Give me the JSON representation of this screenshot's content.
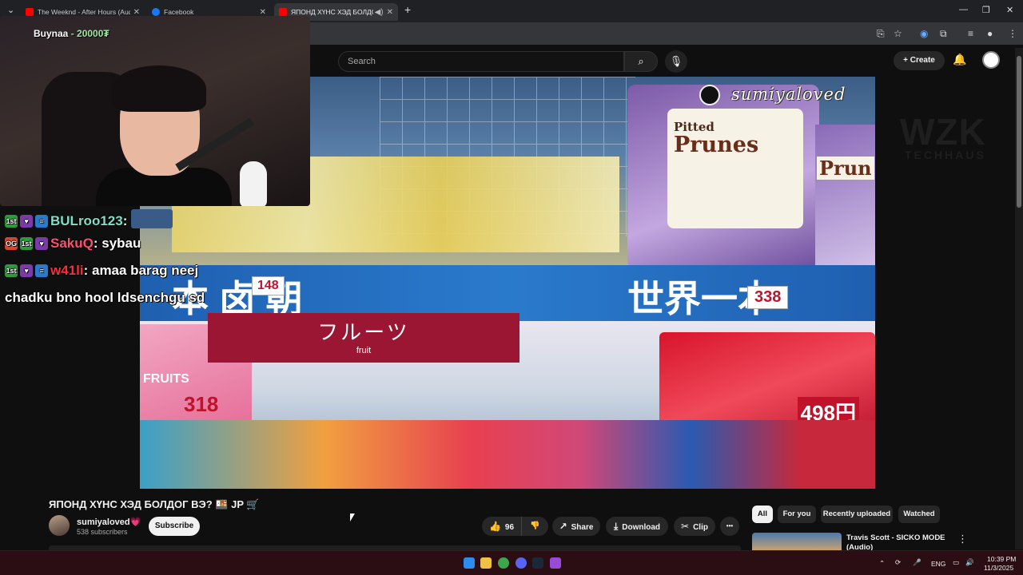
{
  "browser": {
    "tabs": [
      {
        "title": "The Weeknd - After Hours (Aud",
        "icon": "youtube-icon",
        "color": "#ff0000"
      },
      {
        "title": "Facebook",
        "icon": "facebook-icon",
        "color": "#1877f2"
      },
      {
        "title": "ЯПОНД ХҮНС ХЭД БОЛДОГ",
        "icon": "youtube-icon",
        "color": "#ff0000"
      }
    ],
    "new_tab": "+",
    "window_controls": [
      "—",
      "❐",
      "✕"
    ]
  },
  "youtube": {
    "search_placeholder": "Search",
    "create_label": "Create",
    "video": {
      "title": "ЯПОНД ХҮНС ХЭД БОЛДОГ ВЭ? 🍱 JP 🛒",
      "watermark": "sumiyaloved",
      "frame_text": {
        "prunes_1": "Pitted",
        "prunes_2": "Prunes",
        "prunes_3": "Prun",
        "banner_left": "本 卤 朝",
        "banner_right": "世界一本",
        "fruit_kana": "フルーツ",
        "fruit_en": "fruit",
        "price_1": "148",
        "price_2": "318",
        "price_3": "338",
        "price_4": "498円",
        "fruits_label": "FRUITS"
      }
    },
    "channel": {
      "name": "sumiyaloved💗",
      "subscribers": "538 subscribers",
      "subscribe_label": "Subscribe"
    },
    "actions": {
      "likes": "96",
      "share": "Share",
      "download": "Download",
      "clip": "Clip",
      "more": "•••"
    },
    "chips": [
      "All",
      "For you",
      "Recently uploaded",
      "Watched"
    ],
    "recommended": {
      "title": "Travis Scott - SICKO MODE (Audio)"
    }
  },
  "stream_overlay": {
    "donor_name": "Buynaa",
    "donor_amount": "- 20000₮",
    "background_logo": "WZK",
    "background_sub": "TECHHAUS",
    "chat": [
      {
        "badges": [
          "1st",
          "♥",
          "≡"
        ],
        "user": "BULroo123",
        "color": "#7fe0c8",
        "message": "",
        "emote": true
      },
      {
        "badges": [
          "OG",
          "1st",
          "♥"
        ],
        "user": "SakuQ",
        "color": "#ff4f6e",
        "message": "sybau",
        "emote": false
      },
      {
        "badges": [
          "1st",
          "♥",
          "≡"
        ],
        "user": "w41li",
        "color": "#ff2a3a",
        "message": "amaa barag neej",
        "emote": false
      }
    ],
    "chat_continuation": "chadku bno hool ldsenchgu sd"
  },
  "taskbar": {
    "language": "ENG",
    "time": "10:39 PM",
    "date": "11/3/2025"
  }
}
